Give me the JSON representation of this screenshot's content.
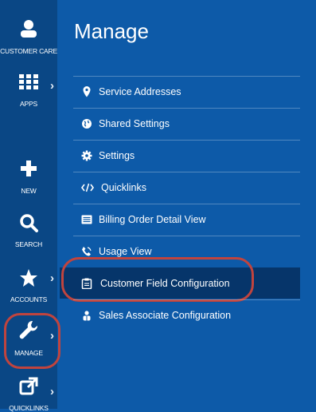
{
  "rail": {
    "items": [
      {
        "label": "CUSTOMER CARE",
        "icon": "person-icon"
      },
      {
        "label": "APPS",
        "icon": "apps-grid-icon"
      },
      {
        "label": "NEW",
        "icon": "plus-icon"
      },
      {
        "label": "SEARCH",
        "icon": "search-icon"
      },
      {
        "label": "ACCOUNTS",
        "icon": "star-icon"
      },
      {
        "label": "MANAGE",
        "icon": "wrench-icon"
      },
      {
        "label": "QUICKLINKS",
        "icon": "external-link-icon"
      }
    ],
    "chevron": "›"
  },
  "panel": {
    "title": "Manage",
    "items": [
      {
        "label": "Service Addresses",
        "icon": "map-pin-icon"
      },
      {
        "label": "Shared Settings",
        "icon": "globe-icon"
      },
      {
        "label": "Settings",
        "icon": "gear-icon"
      },
      {
        "label": "Quicklinks",
        "icon": "code-icon"
      },
      {
        "label": "Billing Order Detail View",
        "icon": "list-icon"
      },
      {
        "label": "Usage View",
        "icon": "phone-icon"
      },
      {
        "label": "Customer Field Configuration",
        "icon": "clipboard-icon"
      },
      {
        "label": "Sales Associate Configuration",
        "icon": "users-icon"
      }
    ]
  },
  "colors": {
    "panel_bg": "#0d5aa8",
    "rail_bg": "#0a4785",
    "active_item_bg": "#06356a",
    "highlight_ring": "#c0443e"
  }
}
